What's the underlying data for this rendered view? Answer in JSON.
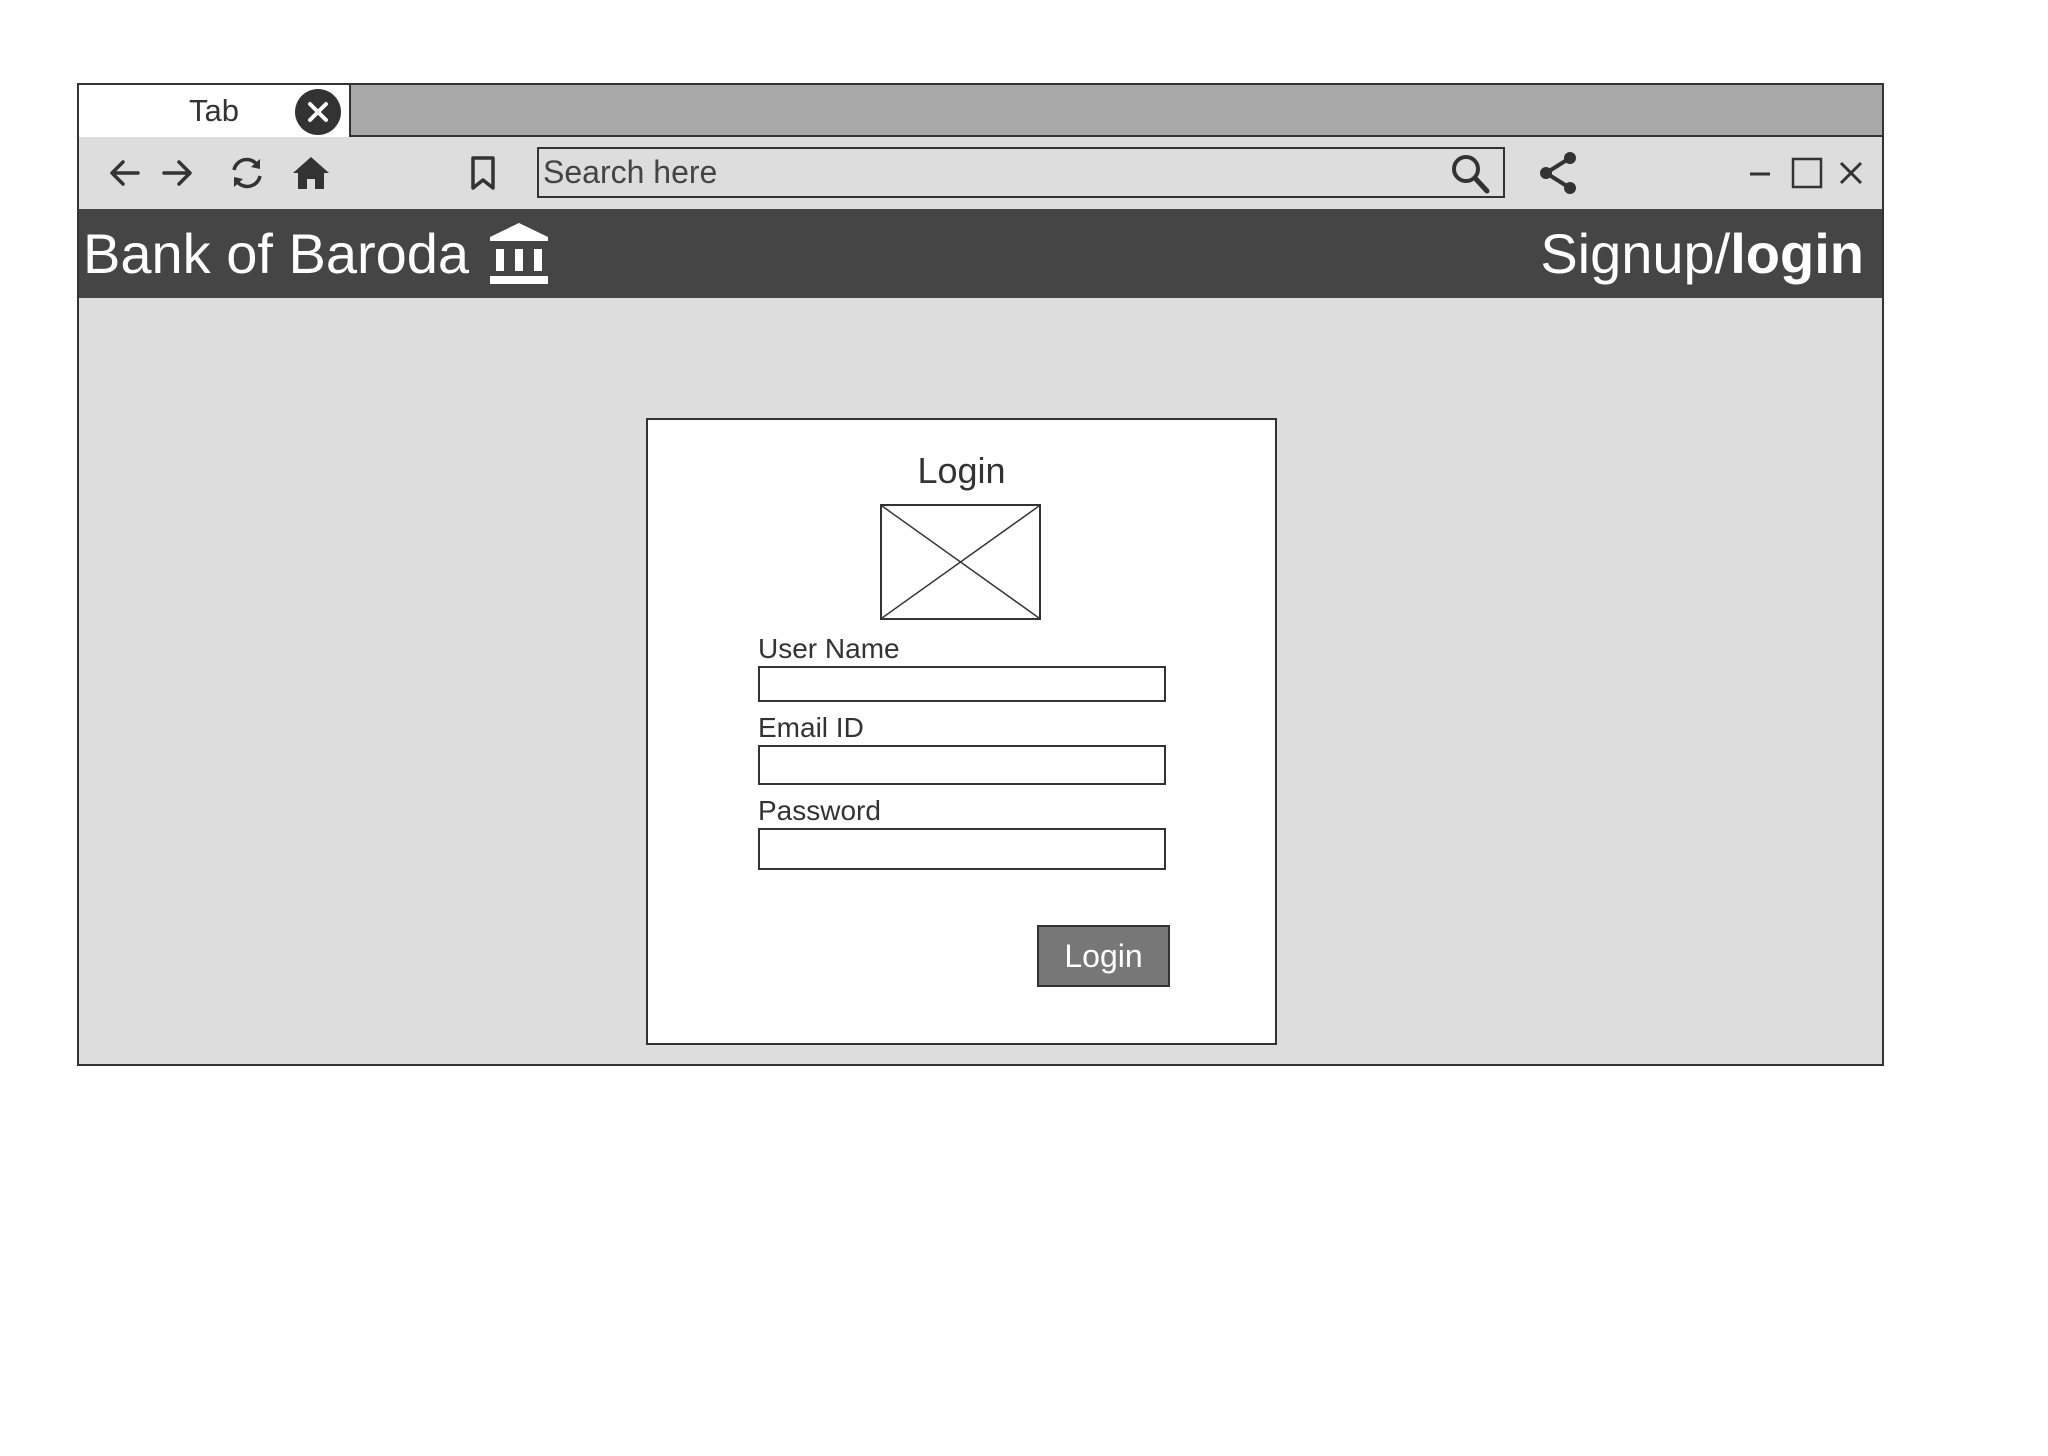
{
  "browser": {
    "tab_label": "Tab",
    "search": {
      "placeholder": "Search here"
    },
    "icons": {
      "tab_close": "close-circle-icon",
      "back": "arrow-left-icon",
      "forward": "arrow-right-icon",
      "reload": "refresh-icon",
      "home": "home-icon",
      "bookmark": "bookmark-icon",
      "search": "search-icon",
      "share": "share-icon",
      "minimize": "minimize-icon",
      "maximize": "maximize-icon",
      "close": "close-icon"
    }
  },
  "header": {
    "brand": "Bank of Baroda",
    "brand_icon": "bank-icon",
    "auth_signup": "Signup/",
    "auth_login": "login"
  },
  "login_card": {
    "title": "Login",
    "image_placeholder": "image-placeholder",
    "fields": [
      {
        "label": "User Name",
        "value": ""
      },
      {
        "label": "Email ID",
        "value": ""
      },
      {
        "label": "Password",
        "value": ""
      }
    ],
    "submit_label": "Login"
  },
  "colors": {
    "header_bg": "#454545",
    "page_bg": "#dddddd",
    "tabbar_bg": "#a8a8a8",
    "button_bg": "#777777",
    "outline": "#333333"
  }
}
